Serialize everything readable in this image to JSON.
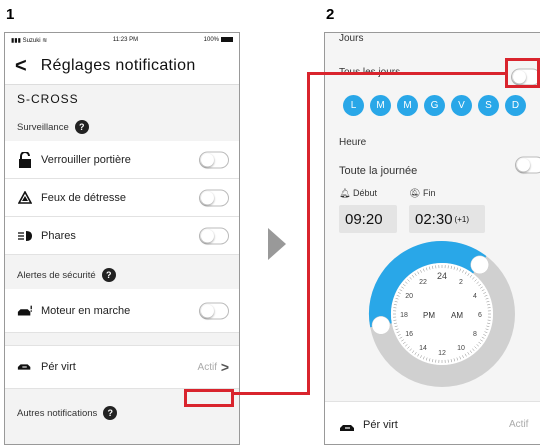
{
  "steps": [
    "1",
    "2"
  ],
  "phone1": {
    "status": {
      "carrier": "Suzuki",
      "time": "11:23 PM",
      "battery": "100%"
    },
    "nav": {
      "title": "Réglages notification"
    },
    "model": "S-CROSS",
    "surveillance": {
      "label": "Surveillance",
      "items": [
        {
          "label": "Verrouiller portière"
        },
        {
          "label": "Feux de détresse"
        },
        {
          "label": "Phares"
        }
      ]
    },
    "security": {
      "label": "Alertes de sécurité",
      "items": [
        {
          "label": "Moteur en marche"
        }
      ]
    },
    "per_virt": {
      "label": "Pér virt",
      "status": "Actif"
    },
    "other": {
      "label": "Autres notifications"
    }
  },
  "phone2": {
    "jours_label": "Jours",
    "tous_les_jours": "Tous les jours",
    "days": [
      "L",
      "M",
      "M",
      "G",
      "V",
      "S",
      "D"
    ],
    "heure_label": "Heure",
    "toute_la_journee": "Toute la journée",
    "debut": {
      "label": "Début",
      "time": "09:20"
    },
    "fin": {
      "label": "Fin",
      "time": "02:30",
      "suffix": "(+1)"
    },
    "dial": {
      "numbers": [
        "24",
        "2",
        "4",
        "6",
        "8",
        "10",
        "12",
        "14",
        "16",
        "18",
        "20",
        "22"
      ],
      "pm": "PM",
      "am": "AM"
    },
    "per_virt": {
      "label": "Pér virt",
      "status": "Actif"
    }
  },
  "colors": {
    "accent": "#29a7e8",
    "annotation": "#d9242d",
    "arc_gray": "#d0d0d0"
  }
}
